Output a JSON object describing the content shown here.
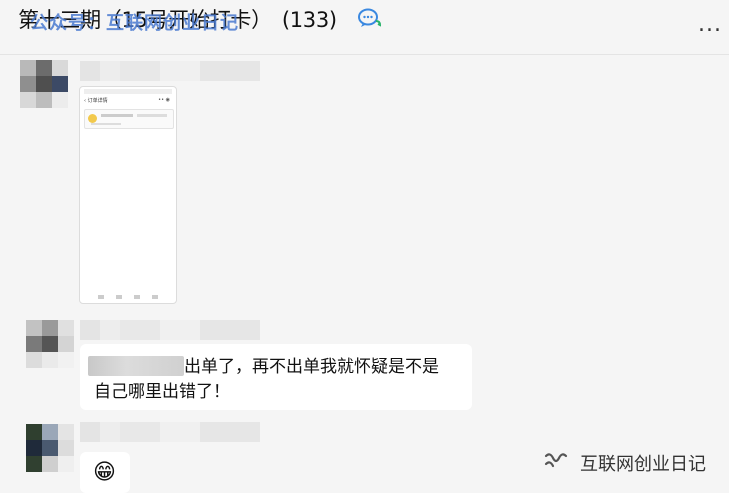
{
  "header": {
    "title": "第十三期（15号开始打卡）",
    "member_count": "(133)",
    "watermark": "公众号：互联网创业日记",
    "more_label": "..."
  },
  "messages": [
    {
      "type": "image",
      "description_alt": ""
    },
    {
      "type": "text",
      "text_line1": "出单了，再不出单我就怀疑是不是",
      "text_line2": "自己哪里出错了！"
    },
    {
      "type": "emoji",
      "emoji": "😁"
    }
  ],
  "brand": {
    "icon": "wechat-channel-icon",
    "text": "互联网创业日记"
  },
  "phone_screenshot": {
    "nav_title": "订单详情"
  },
  "colors": {
    "background": "#f5f5f5",
    "bubble": "#ffffff",
    "watermark": "#4a7ad0"
  }
}
